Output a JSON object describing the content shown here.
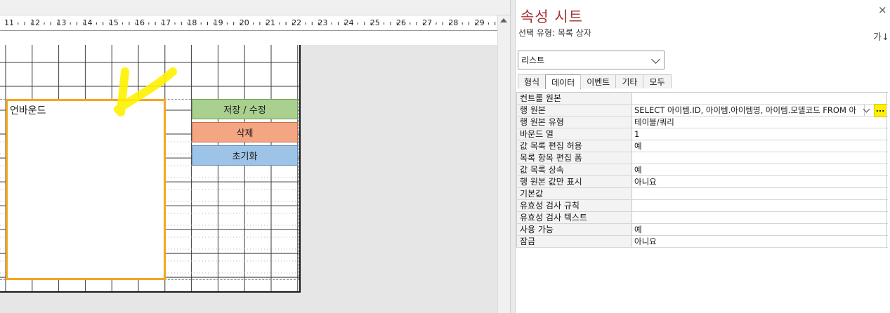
{
  "design": {
    "ruler_numbers": [
      "11",
      "12",
      "13",
      "14",
      "15",
      "16",
      "17",
      "18",
      "19",
      "20",
      "21",
      "22",
      "23",
      "24",
      "25",
      "26",
      "27",
      "28",
      "29"
    ],
    "listbox_label": "언바운드",
    "buttons": {
      "save": "저장 / 수정",
      "delete": "삭제",
      "reset": "초기화"
    },
    "colors": {
      "listbox_border": "#f5a623",
      "highlight_stroke": "#fff100",
      "save": "#a9d08e",
      "delete": "#f4a582",
      "reset": "#9dc3e6"
    }
  },
  "property_sheet": {
    "title": "속성 시트",
    "selection_type": "선택 유형:  목록 상자",
    "close_icon": "×",
    "sort_icon": "가↓",
    "selector_value": "리스트",
    "tabs": [
      "형식",
      "데이터",
      "이벤트",
      "기타",
      "모두"
    ],
    "active_tab": "데이터",
    "rows": [
      {
        "name": "컨트롤 원본",
        "value": ""
      },
      {
        "name": "행 원본",
        "value": "SELECT 아이템.ID, 아이템.아이템명, 아이템.모델코드 FROM 아"
      },
      {
        "name": "행 원본 유형",
        "value": "테이블/쿼리"
      },
      {
        "name": "바운드 열",
        "value": "1"
      },
      {
        "name": "값 목록 편집 허용",
        "value": "예"
      },
      {
        "name": "목록 항목 편집 폼",
        "value": ""
      },
      {
        "name": "값 목록 상속",
        "value": "예"
      },
      {
        "name": "행 원본 값만 표시",
        "value": "아니요"
      },
      {
        "name": "기본값",
        "value": ""
      },
      {
        "name": "유효성 검사 규칙",
        "value": ""
      },
      {
        "name": "유효성 검사 텍스트",
        "value": ""
      },
      {
        "name": "사용 가능",
        "value": "예"
      },
      {
        "name": "잠금",
        "value": "아니요"
      }
    ],
    "builder_button": "...",
    "title_color": "#a4373a"
  }
}
